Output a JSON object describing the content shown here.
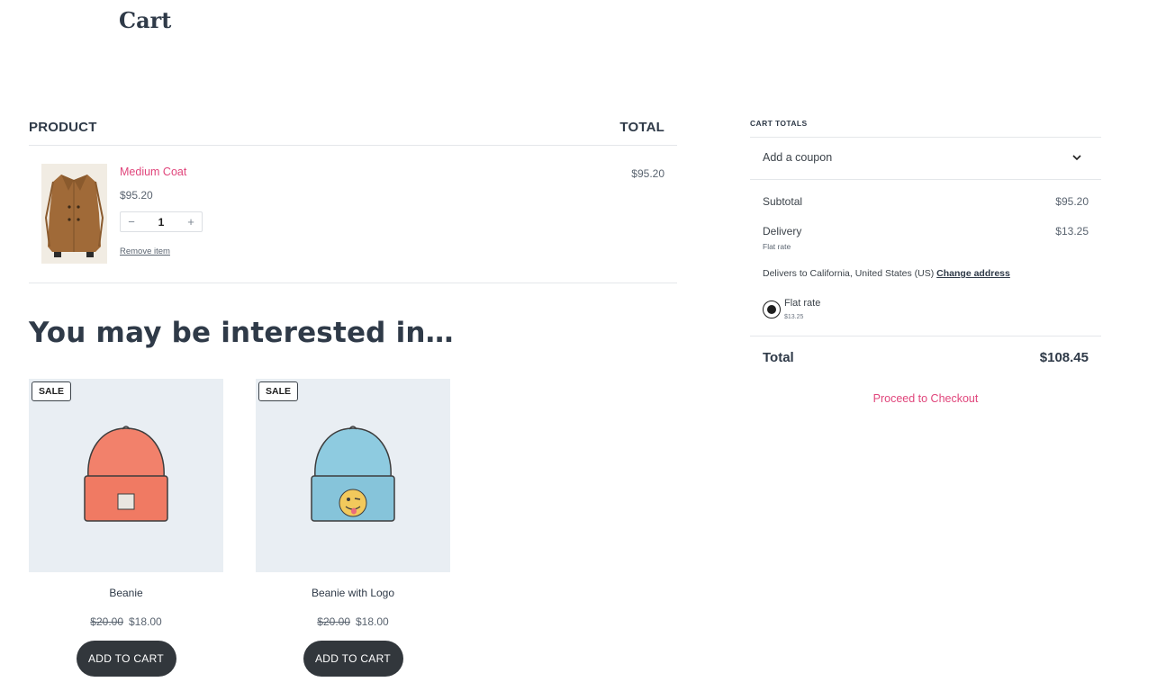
{
  "page": {
    "title": "Cart"
  },
  "table": {
    "product_header": "PRODUCT",
    "total_header": "TOTAL",
    "items": [
      {
        "name": "Medium Coat",
        "price": "$95.20",
        "quantity": "1",
        "minus": "−",
        "plus": "+",
        "remove_label": "Remove item",
        "line_total": "$95.20"
      }
    ]
  },
  "recommendations": {
    "title": "You may be interested in…",
    "products": [
      {
        "badge": "SALE",
        "name": "Beanie",
        "old_price": "$20.00",
        "price": "$18.00",
        "button": "ADD TO CART",
        "image": "orange-beanie-image"
      },
      {
        "badge": "SALE",
        "name": "Beanie with Logo",
        "old_price": "$20.00",
        "price": "$18.00",
        "button": "ADD TO CART",
        "image": "blue-beanie-with-logo-image"
      }
    ]
  },
  "totals": {
    "title": "CART TOTALS",
    "coupon_label": "Add a coupon",
    "coupon_icon": "chevron-down-icon",
    "subtotal_label": "Subtotal",
    "subtotal_value": "$95.20",
    "delivery_label": "Delivery",
    "delivery_method": "Flat rate",
    "delivery_value": "$13.25",
    "delivers_to": "Delivers to California, United States (US)",
    "change_address": "Change address",
    "shipping_option_label": "Flat rate",
    "shipping_option_price": "$13.25",
    "total_label": "Total",
    "total_value": "$108.45",
    "checkout_label": "Proceed to Checkout"
  },
  "colors": {
    "accent": "#e0457b",
    "button_bg": "#32373c",
    "card_bg": "#e9eef3",
    "heading": "#2f3a48"
  }
}
